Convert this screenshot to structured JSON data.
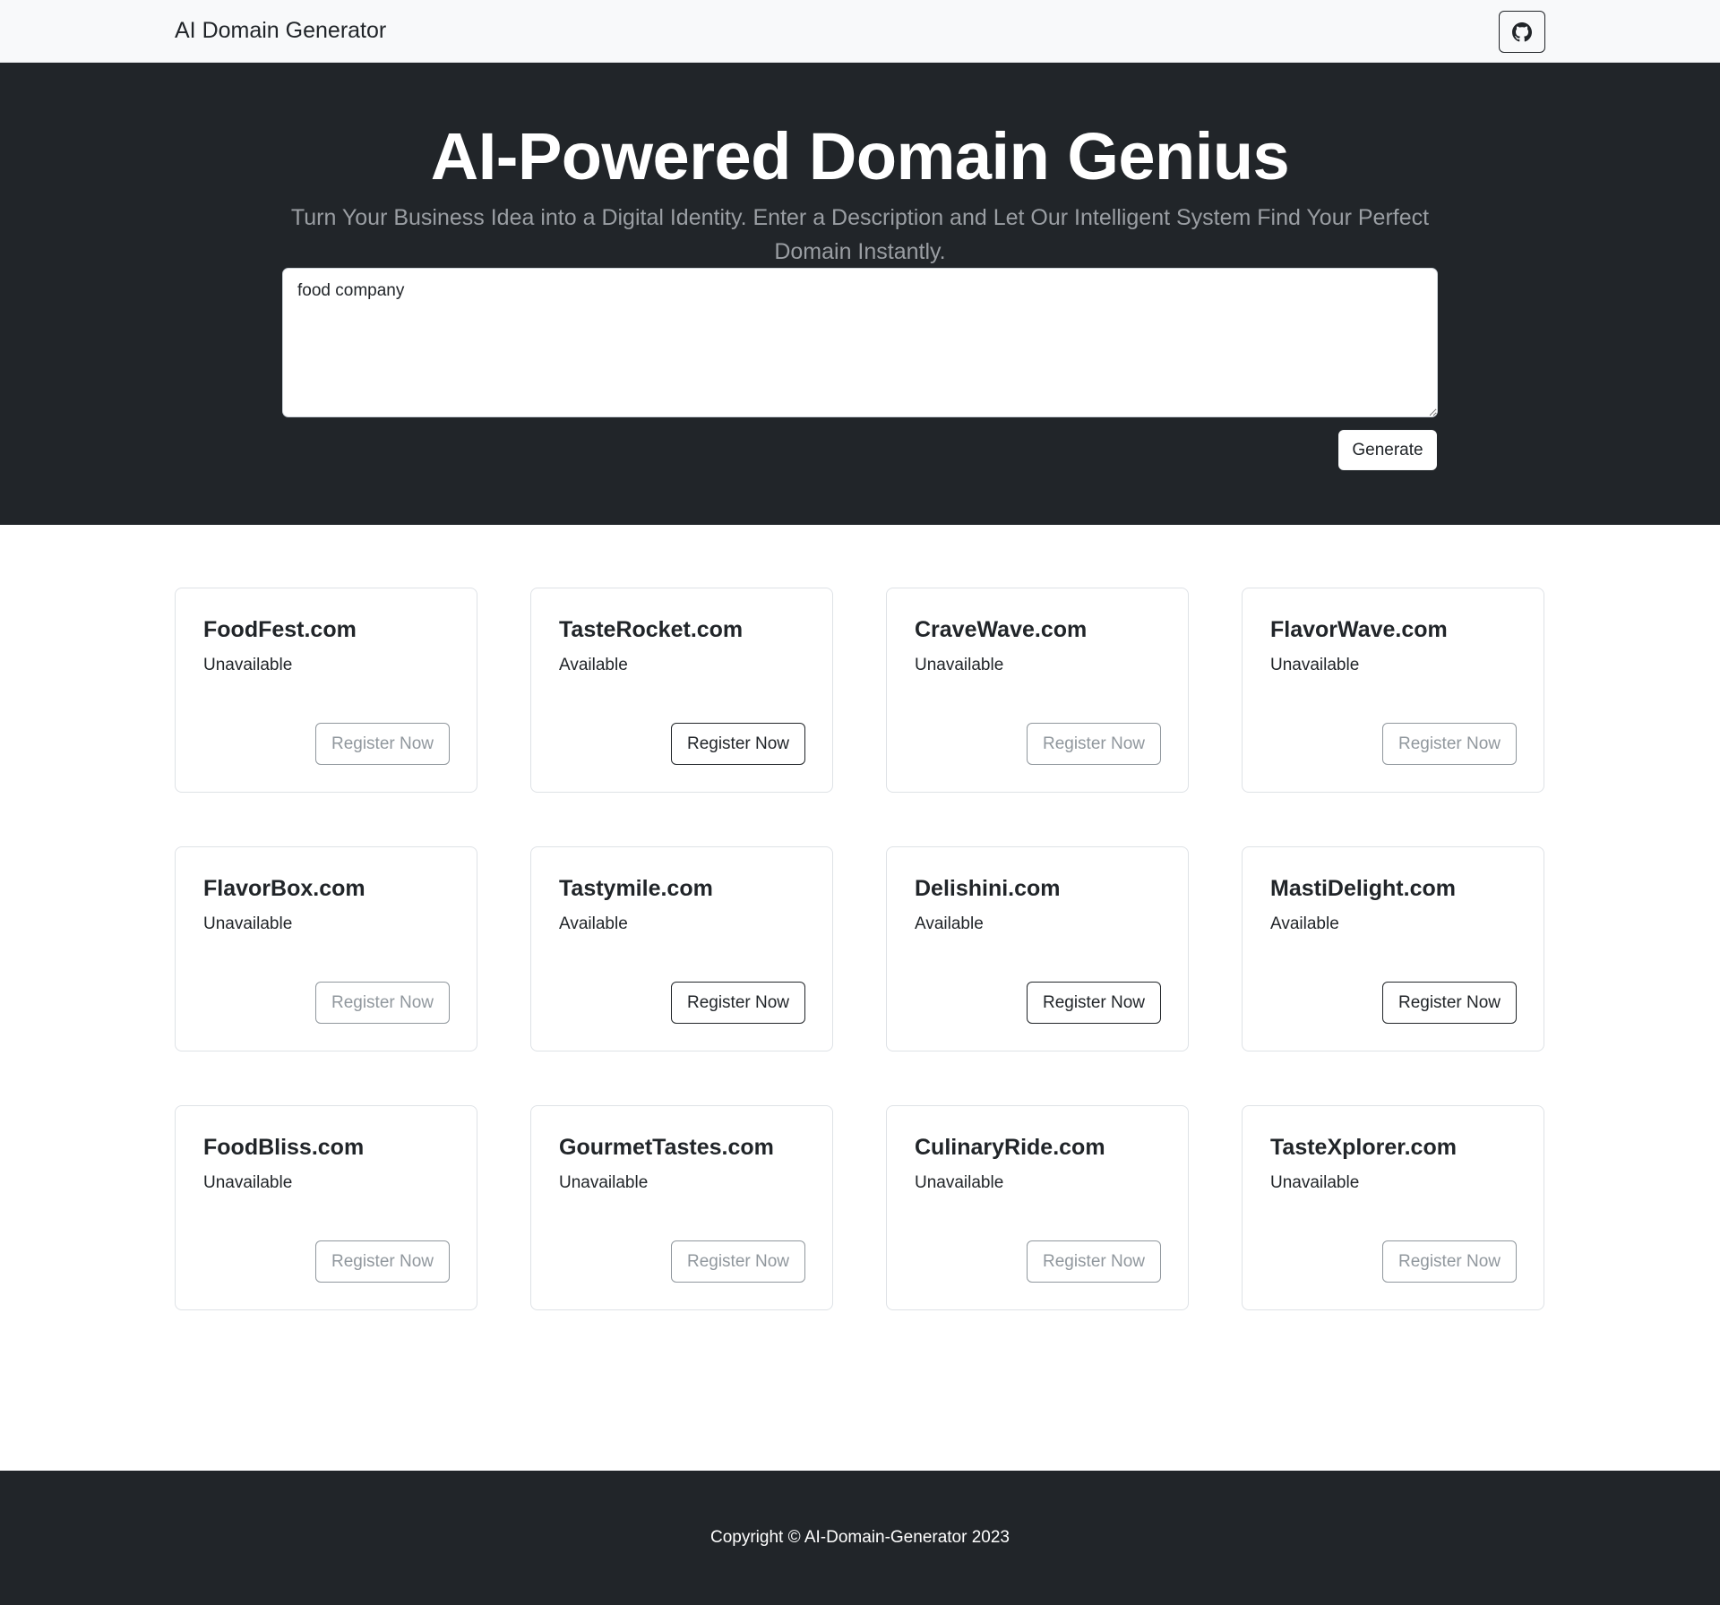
{
  "navbar": {
    "brand": "AI Domain Generator",
    "github_icon": "github-icon"
  },
  "hero": {
    "title": "AI-Powered Domain Genius",
    "subtitle": "Turn Your Business Idea into a Digital Identity. Enter a Description and Let Our Intelligent System Find Your Perfect Domain Instantly.",
    "input_value": "food company",
    "generate_label": "Generate"
  },
  "domains": [
    {
      "name": "FoodFest.com",
      "status": "Unavailable",
      "available": false,
      "button": "Register Now"
    },
    {
      "name": "TasteRocket.com",
      "status": "Available",
      "available": true,
      "button": "Register Now"
    },
    {
      "name": "CraveWave.com",
      "status": "Unavailable",
      "available": false,
      "button": "Register Now"
    },
    {
      "name": "FlavorWave.com",
      "status": "Unavailable",
      "available": false,
      "button": "Register Now"
    },
    {
      "name": "FlavorBox.com",
      "status": "Unavailable",
      "available": false,
      "button": "Register Now"
    },
    {
      "name": "Tastymile.com",
      "status": "Available",
      "available": true,
      "button": "Register Now"
    },
    {
      "name": "Delishini.com",
      "status": "Available",
      "available": true,
      "button": "Register Now"
    },
    {
      "name": "MastiDelight.com",
      "status": "Available",
      "available": true,
      "button": "Register Now"
    },
    {
      "name": "FoodBliss.com",
      "status": "Unavailable",
      "available": false,
      "button": "Register Now"
    },
    {
      "name": "GourmetTastes.com",
      "status": "Unavailable",
      "available": false,
      "button": "Register Now"
    },
    {
      "name": "CulinaryRide.com",
      "status": "Unavailable",
      "available": false,
      "button": "Register Now"
    },
    {
      "name": "TasteXplorer.com",
      "status": "Unavailable",
      "available": false,
      "button": "Register Now"
    }
  ],
  "footer": {
    "text": "Copyright © AI-Domain-Generator 2023"
  },
  "colors": {
    "dark": "#212529",
    "light": "#f8f9fa",
    "muted": "#6c757d"
  }
}
